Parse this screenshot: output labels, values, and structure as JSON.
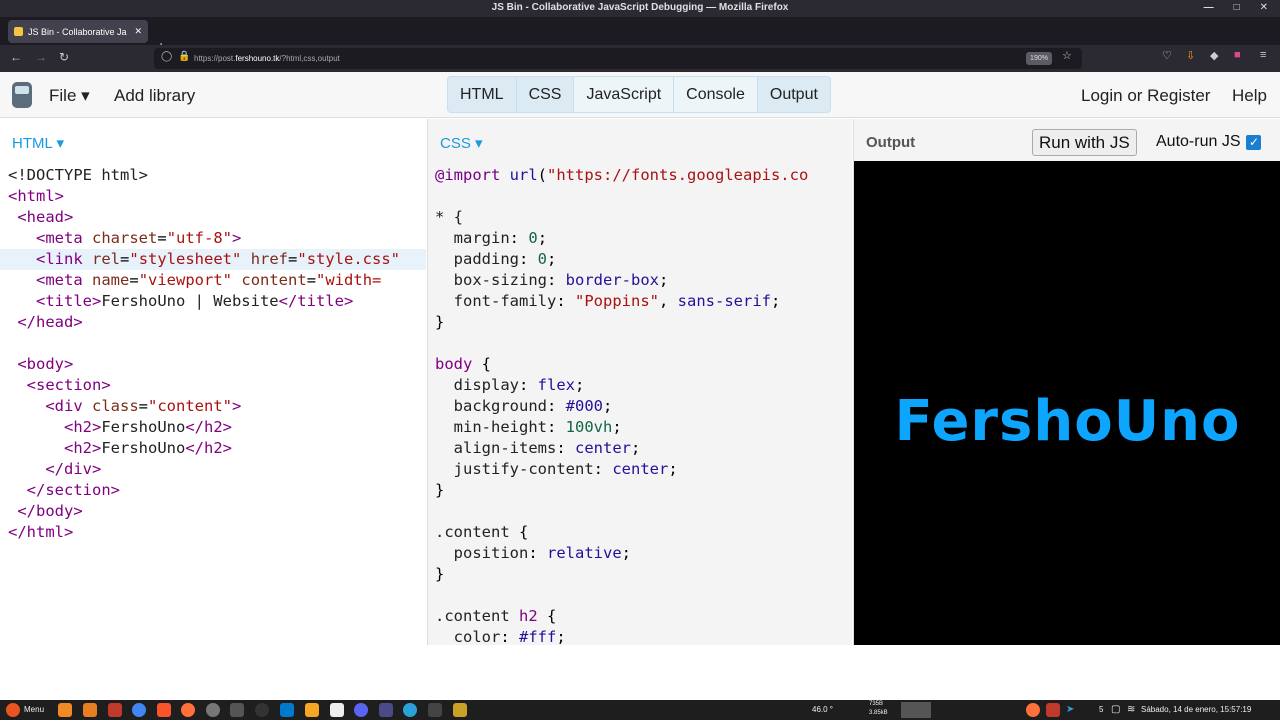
{
  "window": {
    "title": "JS Bin - Collaborative JavaScript Debugging — Mozilla Firefox"
  },
  "browser": {
    "tab_title": "JS Bin - Collaborative Ja",
    "url_prefix": "https://post.",
    "url_domain": "fershouno.tk",
    "url_suffix": "/?html,css,output",
    "zoom": "190%"
  },
  "jsbin": {
    "file_menu": "File ▾",
    "add_library": "Add library",
    "tabs": [
      "HTML",
      "CSS",
      "JavaScript",
      "Console",
      "Output"
    ],
    "login": "Login or Register",
    "help": "Help"
  },
  "html_panel": {
    "label": "HTML ▾"
  },
  "css_panel": {
    "label": "CSS ▾"
  },
  "output_panel": {
    "label": "Output",
    "run_button": "Run with JS",
    "autorun_label": "Auto-run JS",
    "preview_text": "FershoUno"
  },
  "taskbar": {
    "menu": "Menu",
    "temp": "46.0 °",
    "net_up": "735B",
    "net_down": "3.85kB",
    "workspace": "5",
    "datetime": "Sábado, 14 de enero, 15:57:19"
  }
}
